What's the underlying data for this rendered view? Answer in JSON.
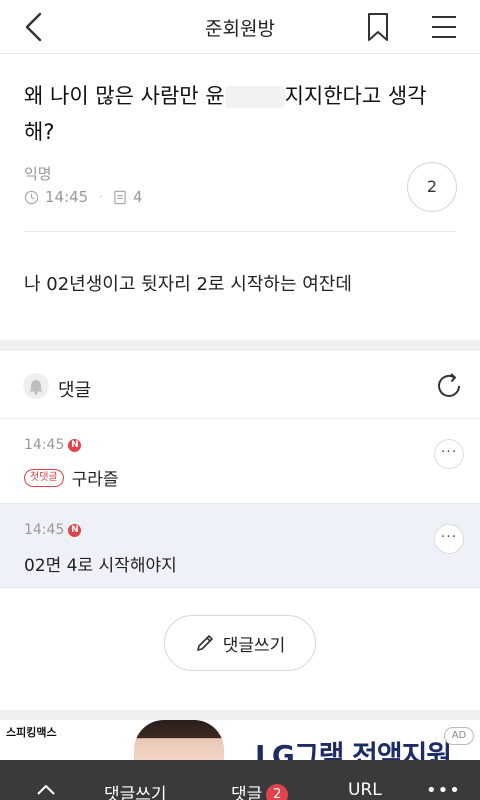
{
  "header": {
    "title": "준회원방"
  },
  "post": {
    "title_part1": "왜 나이 많은 사람만 윤",
    "title_part2": "지지한다고 생각해?",
    "author": "익명",
    "time": "14:45",
    "view_count": "4",
    "comment_count": "2",
    "body": "나 02년생이고 뒷자리 2로 시작하는 여잔데"
  },
  "comments_section": {
    "label": "댓글"
  },
  "comments": [
    {
      "time": "14:45",
      "new_badge": "N",
      "first_badge": "첫댓글",
      "text": "구라즐"
    },
    {
      "time": "14:45",
      "new_badge": "N",
      "text": "02면 4로 시작해야지"
    }
  ],
  "write_button": {
    "label": "댓글쓰기"
  },
  "ad": {
    "brand": "스피킹맥스",
    "headline": "LG그램 전액지원",
    "ad_mark": "AD"
  },
  "bottom_bar": {
    "write_label": "댓글쓰기",
    "comments_label": "댓글",
    "comments_count": "2",
    "url_label": "URL",
    "more_label": "•••"
  },
  "colors": {
    "accent_red": "#e0434b",
    "highlight_row": "#eef2f8",
    "bottom_bar": "#3a3a3c"
  }
}
